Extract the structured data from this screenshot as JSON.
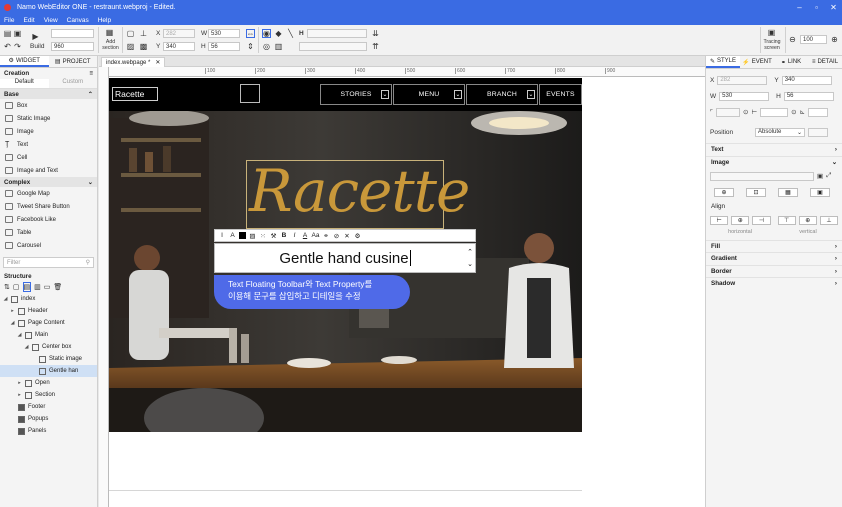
{
  "title_bar": {
    "title": "Namo WebEditor ONE - restraunt.webproj - Edited.",
    "min": "–",
    "max": "▫",
    "close": "✕"
  },
  "menu": [
    "File",
    "Edit",
    "View",
    "Canvas",
    "Help"
  ],
  "toolbar": {
    "build_label": "Build",
    "width_select": "960",
    "add_section_label": "Add section",
    "x_label": "X",
    "x_value": "282",
    "y_label": "Y",
    "y_value": "340",
    "w_label": "W",
    "w_value": "530",
    "h_label": "H",
    "h_value": "56",
    "tracing_label": "Tracing screen",
    "zoom_value": "100"
  },
  "left_panel": {
    "tabs": [
      "WIDGET",
      "PROJECT"
    ],
    "creation_label": "Creation",
    "subtabs": [
      "Default",
      "Custom"
    ],
    "base_label": "Base",
    "base_items": [
      "Box",
      "Static Image",
      "Image",
      "Text",
      "Cell",
      "Image and Text"
    ],
    "complex_label": "Complex",
    "complex_items": [
      "Google Map",
      "Tweet Share Button",
      "Facebook Like",
      "Table",
      "Carousel"
    ],
    "filter_placeholder": "Filter",
    "structure_label": "Structure",
    "tree": [
      {
        "label": "index",
        "indent": 0
      },
      {
        "label": "Header",
        "indent": 1
      },
      {
        "label": "Page Content",
        "indent": 1
      },
      {
        "label": "Main",
        "indent": 2
      },
      {
        "label": "Center box",
        "indent": 3
      },
      {
        "label": "Static image",
        "indent": 4
      },
      {
        "label": "Gentle han",
        "indent": 4
      },
      {
        "label": "Open",
        "indent": 2
      },
      {
        "label": "Section",
        "indent": 2
      },
      {
        "label": "Footer",
        "indent": 1
      },
      {
        "label": "Popups",
        "indent": 1
      },
      {
        "label": "Panels",
        "indent": 1
      }
    ]
  },
  "document": {
    "tab_label": "index.webpage *",
    "tab_close": "✕"
  },
  "ruler": {
    "ticks": [
      "100",
      "200",
      "300",
      "400",
      "500",
      "600",
      "700",
      "800",
      "900"
    ]
  },
  "site": {
    "logo": "Racette",
    "nav": [
      "STORIES",
      "MENU",
      "BRANCH",
      "EVENTS"
    ],
    "hero_script": "Racette",
    "editing_text": "Gentle hand cusine",
    "callout_line1": "Text Floating Toolbar와 Text Property를",
    "callout_line2": "이용해 문구를 삽입하고 디테일을 수정"
  },
  "right_panel": {
    "tabs": [
      "STYLE",
      "EVENT",
      "LINK",
      "DETAIL"
    ],
    "x_label": "X",
    "x_value": "282",
    "y_label": "Y",
    "y_value": "340",
    "w_label": "W",
    "w_value": "530",
    "h_label": "H",
    "h_value": "56",
    "position_label": "Position",
    "position_value": "Absolute",
    "text_section": "Text",
    "image_section": "Image",
    "align_label": "Align",
    "align_h": "horizontal",
    "align_v": "vertical",
    "sections": [
      "Fill",
      "Gradient",
      "Border",
      "Shadow"
    ]
  },
  "colors": {
    "accent": "#3a6be3",
    "callout": "#4f6ae8",
    "gold": "#c9983a"
  }
}
